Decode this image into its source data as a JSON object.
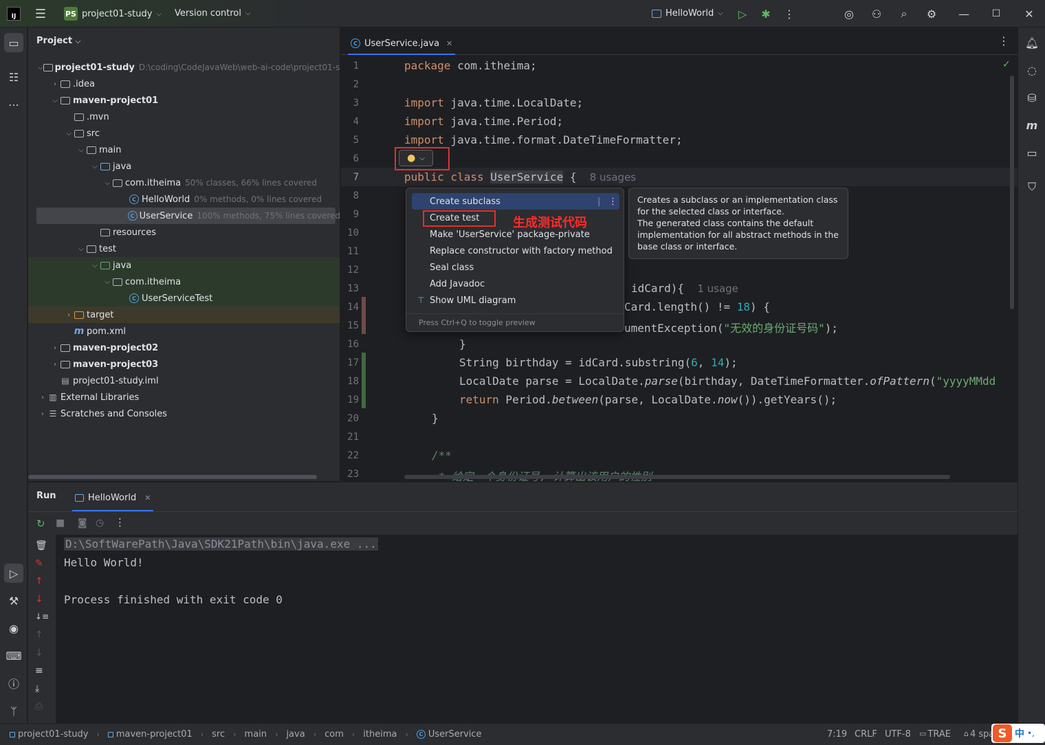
{
  "titlebar": {
    "project_badge": "PS",
    "project_name": "project01-study",
    "vcs": "Version control",
    "run_config": "HelloWorld"
  },
  "project_panel": {
    "title": "Project",
    "tree": [
      {
        "label": "project01-study",
        "extra": "D:\\coding\\CodeJavaWeb\\web-ai-code\\project01-st",
        "bold": true
      },
      {
        "label": ".idea"
      },
      {
        "label": "maven-project01",
        "bold": true
      },
      {
        "label": ".mvn"
      },
      {
        "label": "src"
      },
      {
        "label": "main"
      },
      {
        "label": "java"
      },
      {
        "label": "com.itheima",
        "extra": "50% classes, 66% lines covered"
      },
      {
        "label": "HelloWorld",
        "extra": "0% methods, 0% lines covered"
      },
      {
        "label": "UserService",
        "extra": "100% methods, 75% lines covered"
      },
      {
        "label": "resources"
      },
      {
        "label": "test"
      },
      {
        "label": "java"
      },
      {
        "label": "com.itheima"
      },
      {
        "label": "UserServiceTest"
      },
      {
        "label": "target"
      },
      {
        "label": "pom.xml"
      },
      {
        "label": "maven-project02",
        "bold": true
      },
      {
        "label": "maven-project03",
        "bold": true
      },
      {
        "label": "project01-study.iml"
      },
      {
        "label": "External Libraries"
      },
      {
        "label": "Scratches and Consoles"
      }
    ]
  },
  "editor": {
    "tab": "UserService.java",
    "line_numbers": [
      "1",
      "2",
      "3",
      "4",
      "5",
      "6",
      "7",
      "8",
      "9",
      "10",
      "11",
      "12",
      "13",
      "14",
      "15",
      "16",
      "17",
      "18",
      "19",
      "20",
      "21",
      "22",
      "23"
    ],
    "code": {
      "l1_kw": "package",
      "l1_rest": " com.itheima;",
      "l3_kw": "import",
      "l3_rest": " java.time.LocalDate;",
      "l4_kw": "import",
      "l4_rest": " java.time.Period;",
      "l5_kw": "import",
      "l5_rest": " java.time.format.DateTimeFormatter;",
      "l7_kw": "public class",
      "l7_name": "UserService",
      "l7_brace": " {",
      "l7_hint": "8 usages",
      "l13_a": "idCard){",
      "l13_hint": "1 usage",
      "l14_a": "Card.length() != ",
      "l14_num": "18",
      "l14_b": ") {",
      "l15_a": "umentException(",
      "l15_str": "\"无效的身份证号码\"",
      "l15_b": ");",
      "l16": "}",
      "l17_a": "String birthday = idCard.substring(",
      "l17_n1": "6",
      "l17_c": ", ",
      "l17_n2": "14",
      "l17_b": ");",
      "l18_a": "LocalDate parse = LocalDate.",
      "l18_fn": "parse",
      "l18_b": "(birthday, DateTimeFormatter.",
      "l18_fn2": "ofPattern",
      "l18_c": "(",
      "l18_str": "\"yyyyMMdd",
      "l19_kw": "return",
      "l19_a": " Period.",
      "l19_fn": "between",
      "l19_b": "(parse, LocalDate.",
      "l19_fn2": "now",
      "l19_c": "()).getYears();",
      "l20": "}",
      "l22": "/**",
      "l23": " * 给定一个身份证号, 计算出该用户的性别"
    }
  },
  "intentions": {
    "items": [
      "Create subclass",
      "Create test",
      "Make 'UserService' package-private",
      "Replace constructor with factory method",
      "Seal class",
      "Add Javadoc",
      "Show UML diagram"
    ],
    "footer": "Press Ctrl+Q to toggle preview",
    "annotation": "生成测试代码"
  },
  "preview": {
    "text": "Creates a subclass or an implementation class for the selected class or interface.\nThe generated class contains the default implementation for all abstract methods in the base class or interface."
  },
  "run": {
    "title": "Run",
    "tab": "HelloWorld",
    "lines": [
      "D:\\SoftWarePath\\Java\\SDK21Path\\bin\\java.exe ...",
      "Hello World!",
      "",
      "Process finished with exit code 0"
    ]
  },
  "statusbar": {
    "breadcrumbs": [
      "project01-study",
      "maven-project01",
      "src",
      "main",
      "java",
      "com",
      "itheima",
      "UserService"
    ],
    "position": "7:19",
    "line_sep": "CRLF",
    "encoding": "UTF-8",
    "trae": "TRAE",
    "indent": "4 spa",
    "ime": "中"
  }
}
